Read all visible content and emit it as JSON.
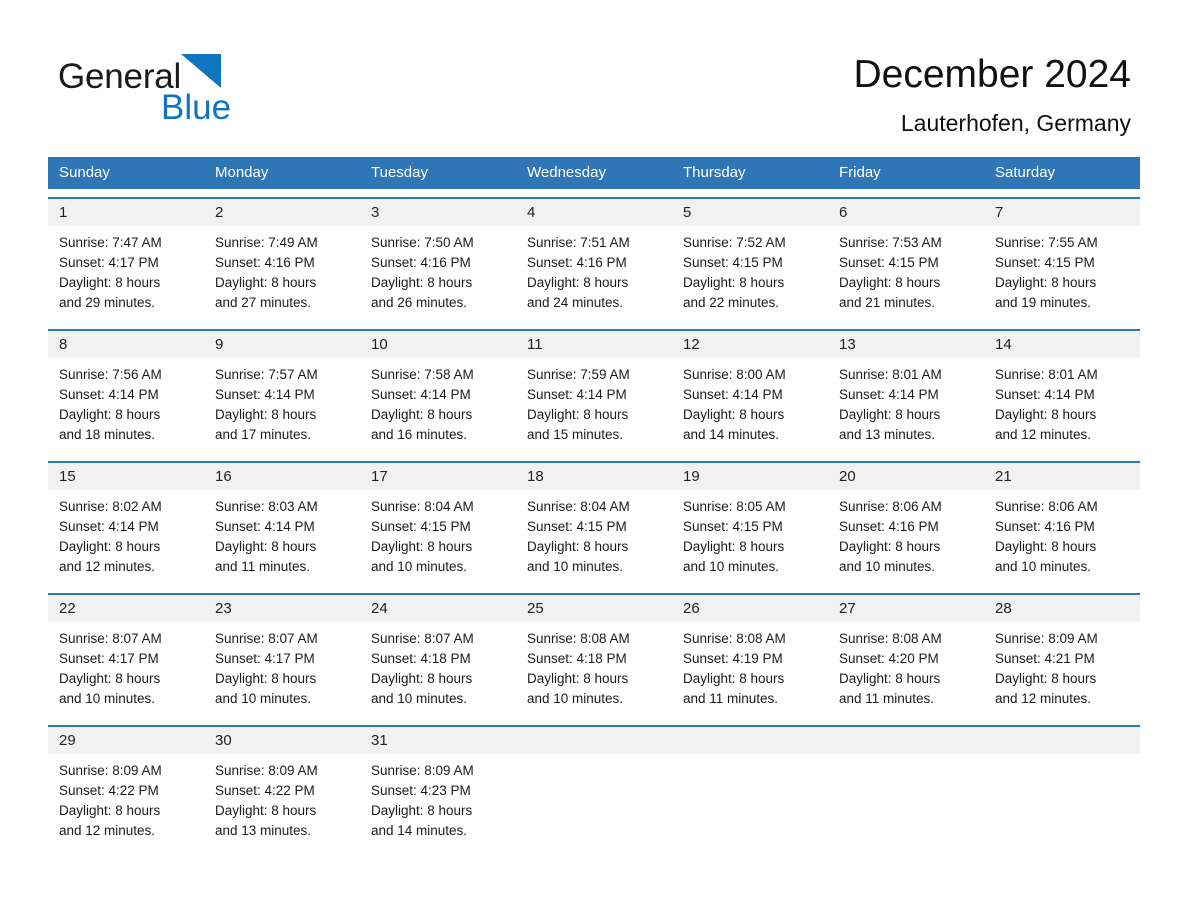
{
  "brand": {
    "word1": "General",
    "word2": "Blue",
    "logo_icon": "triangle-logo-icon",
    "accent_color": "#1175bd"
  },
  "header": {
    "title": "December 2024",
    "subtitle": "Lauterhofen, Germany"
  },
  "calendar": {
    "header_color": "#2f76b6",
    "weekdays": [
      "Sunday",
      "Monday",
      "Tuesday",
      "Wednesday",
      "Thursday",
      "Friday",
      "Saturday"
    ],
    "weeks": [
      [
        {
          "day": "1",
          "sunrise": "Sunrise: 7:47 AM",
          "sunset": "Sunset: 4:17 PM",
          "daylight1": "Daylight: 8 hours",
          "daylight2": "and 29 minutes."
        },
        {
          "day": "2",
          "sunrise": "Sunrise: 7:49 AM",
          "sunset": "Sunset: 4:16 PM",
          "daylight1": "Daylight: 8 hours",
          "daylight2": "and 27 minutes."
        },
        {
          "day": "3",
          "sunrise": "Sunrise: 7:50 AM",
          "sunset": "Sunset: 4:16 PM",
          "daylight1": "Daylight: 8 hours",
          "daylight2": "and 26 minutes."
        },
        {
          "day": "4",
          "sunrise": "Sunrise: 7:51 AM",
          "sunset": "Sunset: 4:16 PM",
          "daylight1": "Daylight: 8 hours",
          "daylight2": "and 24 minutes."
        },
        {
          "day": "5",
          "sunrise": "Sunrise: 7:52 AM",
          "sunset": "Sunset: 4:15 PM",
          "daylight1": "Daylight: 8 hours",
          "daylight2": "and 22 minutes."
        },
        {
          "day": "6",
          "sunrise": "Sunrise: 7:53 AM",
          "sunset": "Sunset: 4:15 PM",
          "daylight1": "Daylight: 8 hours",
          "daylight2": "and 21 minutes."
        },
        {
          "day": "7",
          "sunrise": "Sunrise: 7:55 AM",
          "sunset": "Sunset: 4:15 PM",
          "daylight1": "Daylight: 8 hours",
          "daylight2": "and 19 minutes."
        }
      ],
      [
        {
          "day": "8",
          "sunrise": "Sunrise: 7:56 AM",
          "sunset": "Sunset: 4:14 PM",
          "daylight1": "Daylight: 8 hours",
          "daylight2": "and 18 minutes."
        },
        {
          "day": "9",
          "sunrise": "Sunrise: 7:57 AM",
          "sunset": "Sunset: 4:14 PM",
          "daylight1": "Daylight: 8 hours",
          "daylight2": "and 17 minutes."
        },
        {
          "day": "10",
          "sunrise": "Sunrise: 7:58 AM",
          "sunset": "Sunset: 4:14 PM",
          "daylight1": "Daylight: 8 hours",
          "daylight2": "and 16 minutes."
        },
        {
          "day": "11",
          "sunrise": "Sunrise: 7:59 AM",
          "sunset": "Sunset: 4:14 PM",
          "daylight1": "Daylight: 8 hours",
          "daylight2": "and 15 minutes."
        },
        {
          "day": "12",
          "sunrise": "Sunrise: 8:00 AM",
          "sunset": "Sunset: 4:14 PM",
          "daylight1": "Daylight: 8 hours",
          "daylight2": "and 14 minutes."
        },
        {
          "day": "13",
          "sunrise": "Sunrise: 8:01 AM",
          "sunset": "Sunset: 4:14 PM",
          "daylight1": "Daylight: 8 hours",
          "daylight2": "and 13 minutes."
        },
        {
          "day": "14",
          "sunrise": "Sunrise: 8:01 AM",
          "sunset": "Sunset: 4:14 PM",
          "daylight1": "Daylight: 8 hours",
          "daylight2": "and 12 minutes."
        }
      ],
      [
        {
          "day": "15",
          "sunrise": "Sunrise: 8:02 AM",
          "sunset": "Sunset: 4:14 PM",
          "daylight1": "Daylight: 8 hours",
          "daylight2": "and 12 minutes."
        },
        {
          "day": "16",
          "sunrise": "Sunrise: 8:03 AM",
          "sunset": "Sunset: 4:14 PM",
          "daylight1": "Daylight: 8 hours",
          "daylight2": "and 11 minutes."
        },
        {
          "day": "17",
          "sunrise": "Sunrise: 8:04 AM",
          "sunset": "Sunset: 4:15 PM",
          "daylight1": "Daylight: 8 hours",
          "daylight2": "and 10 minutes."
        },
        {
          "day": "18",
          "sunrise": "Sunrise: 8:04 AM",
          "sunset": "Sunset: 4:15 PM",
          "daylight1": "Daylight: 8 hours",
          "daylight2": "and 10 minutes."
        },
        {
          "day": "19",
          "sunrise": "Sunrise: 8:05 AM",
          "sunset": "Sunset: 4:15 PM",
          "daylight1": "Daylight: 8 hours",
          "daylight2": "and 10 minutes."
        },
        {
          "day": "20",
          "sunrise": "Sunrise: 8:06 AM",
          "sunset": "Sunset: 4:16 PM",
          "daylight1": "Daylight: 8 hours",
          "daylight2": "and 10 minutes."
        },
        {
          "day": "21",
          "sunrise": "Sunrise: 8:06 AM",
          "sunset": "Sunset: 4:16 PM",
          "daylight1": "Daylight: 8 hours",
          "daylight2": "and 10 minutes."
        }
      ],
      [
        {
          "day": "22",
          "sunrise": "Sunrise: 8:07 AM",
          "sunset": "Sunset: 4:17 PM",
          "daylight1": "Daylight: 8 hours",
          "daylight2": "and 10 minutes."
        },
        {
          "day": "23",
          "sunrise": "Sunrise: 8:07 AM",
          "sunset": "Sunset: 4:17 PM",
          "daylight1": "Daylight: 8 hours",
          "daylight2": "and 10 minutes."
        },
        {
          "day": "24",
          "sunrise": "Sunrise: 8:07 AM",
          "sunset": "Sunset: 4:18 PM",
          "daylight1": "Daylight: 8 hours",
          "daylight2": "and 10 minutes."
        },
        {
          "day": "25",
          "sunrise": "Sunrise: 8:08 AM",
          "sunset": "Sunset: 4:18 PM",
          "daylight1": "Daylight: 8 hours",
          "daylight2": "and 10 minutes."
        },
        {
          "day": "26",
          "sunrise": "Sunrise: 8:08 AM",
          "sunset": "Sunset: 4:19 PM",
          "daylight1": "Daylight: 8 hours",
          "daylight2": "and 11 minutes."
        },
        {
          "day": "27",
          "sunrise": "Sunrise: 8:08 AM",
          "sunset": "Sunset: 4:20 PM",
          "daylight1": "Daylight: 8 hours",
          "daylight2": "and 11 minutes."
        },
        {
          "day": "28",
          "sunrise": "Sunrise: 8:09 AM",
          "sunset": "Sunset: 4:21 PM",
          "daylight1": "Daylight: 8 hours",
          "daylight2": "and 12 minutes."
        }
      ],
      [
        {
          "day": "29",
          "sunrise": "Sunrise: 8:09 AM",
          "sunset": "Sunset: 4:22 PM",
          "daylight1": "Daylight: 8 hours",
          "daylight2": "and 12 minutes."
        },
        {
          "day": "30",
          "sunrise": "Sunrise: 8:09 AM",
          "sunset": "Sunset: 4:22 PM",
          "daylight1": "Daylight: 8 hours",
          "daylight2": "and 13 minutes."
        },
        {
          "day": "31",
          "sunrise": "Sunrise: 8:09 AM",
          "sunset": "Sunset: 4:23 PM",
          "daylight1": "Daylight: 8 hours",
          "daylight2": "and 14 minutes."
        },
        {
          "day": "",
          "sunrise": "",
          "sunset": "",
          "daylight1": "",
          "daylight2": ""
        },
        {
          "day": "",
          "sunrise": "",
          "sunset": "",
          "daylight1": "",
          "daylight2": ""
        },
        {
          "day": "",
          "sunrise": "",
          "sunset": "",
          "daylight1": "",
          "daylight2": ""
        },
        {
          "day": "",
          "sunrise": "",
          "sunset": "",
          "daylight1": "",
          "daylight2": ""
        }
      ]
    ]
  }
}
